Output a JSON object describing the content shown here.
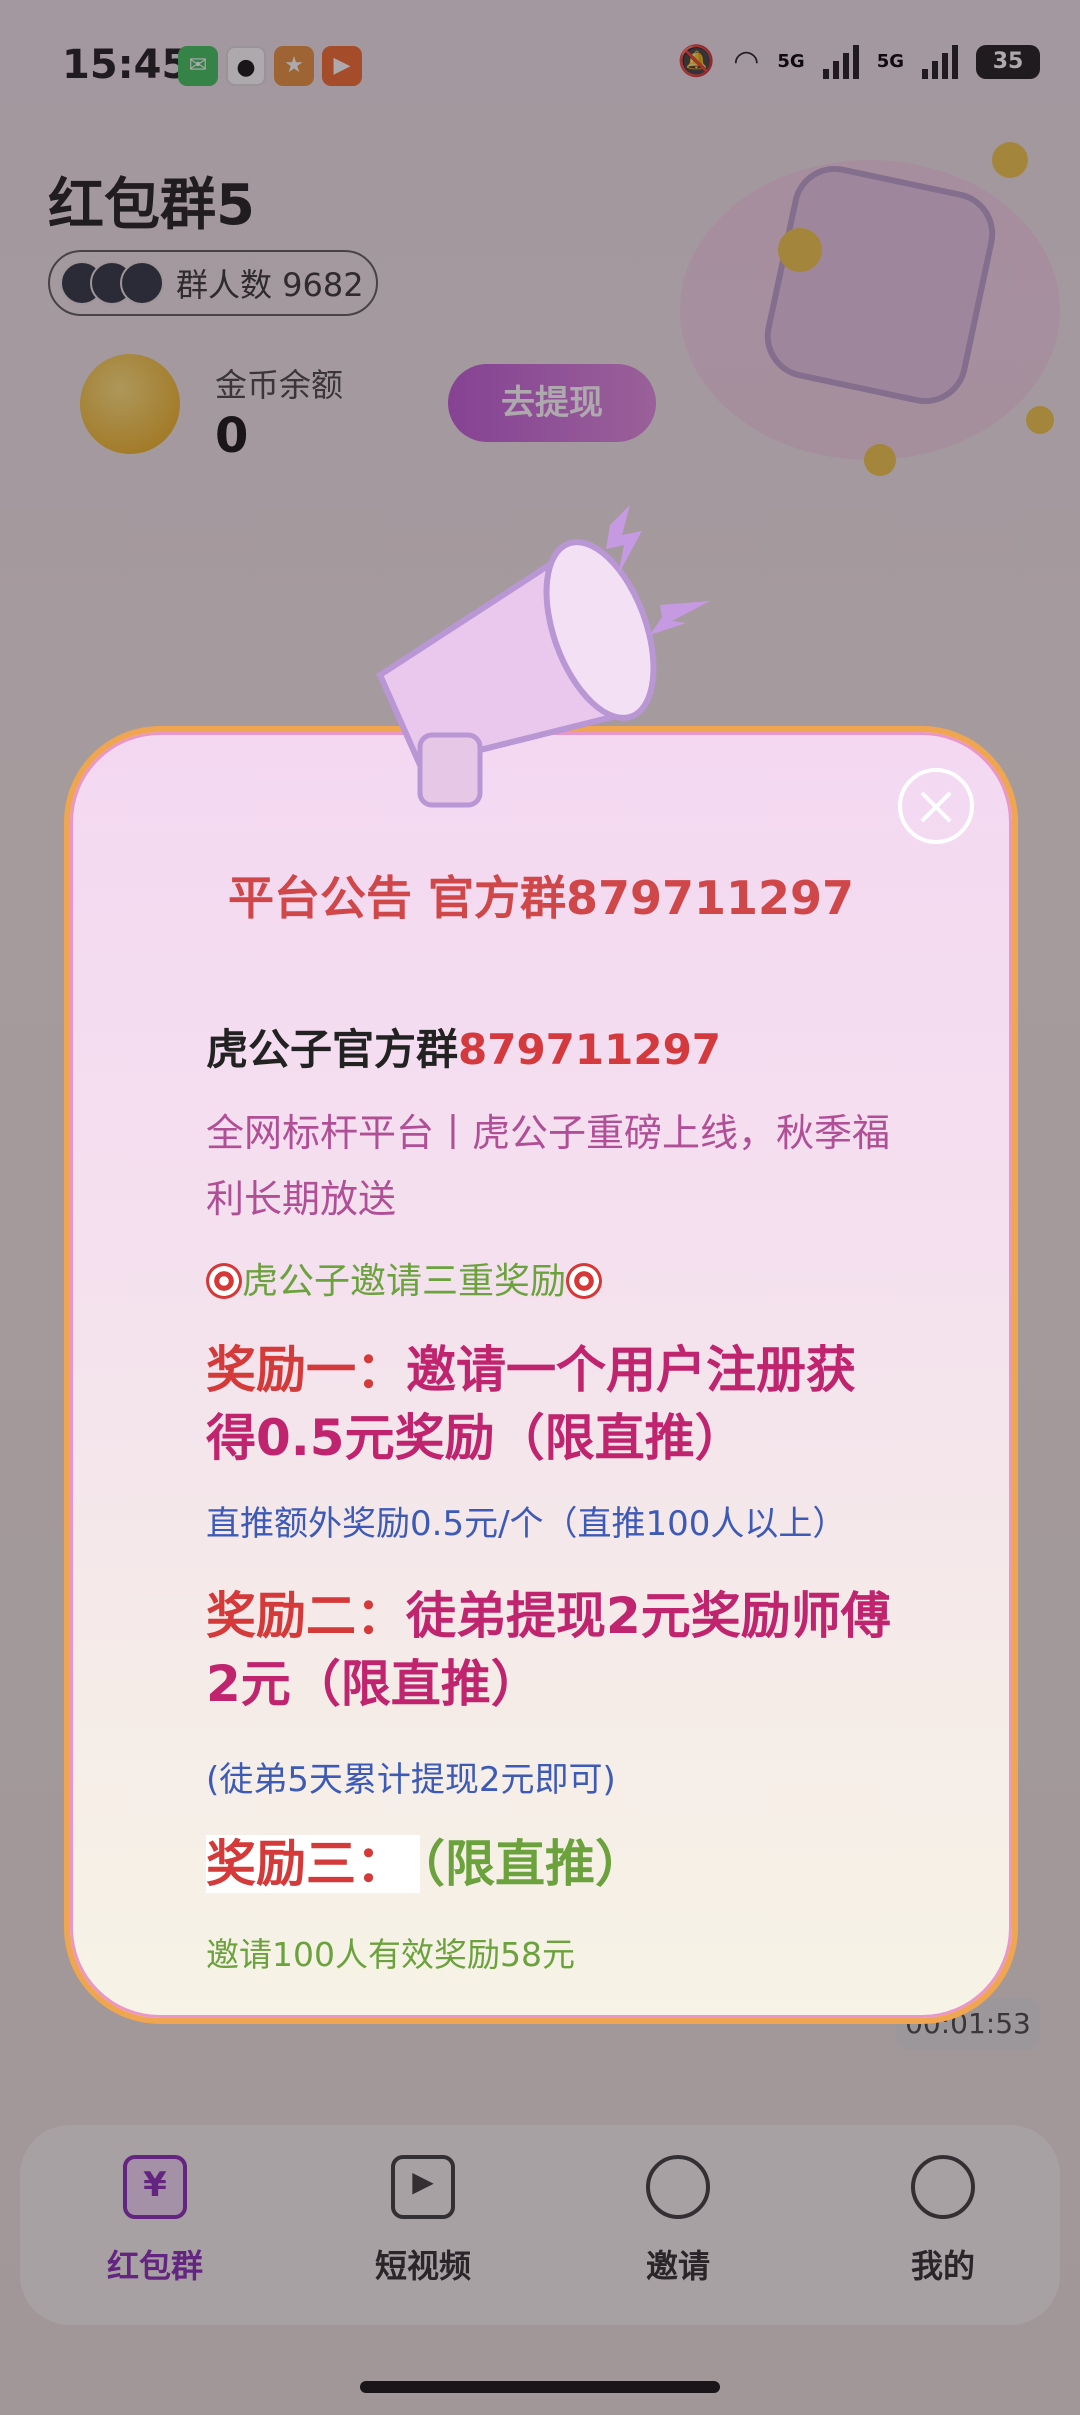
{
  "status_bar": {
    "time": "15:45",
    "network": "5G",
    "battery": "35"
  },
  "header": {
    "title": "红包群5",
    "members_label": "群人数 9682"
  },
  "balance": {
    "label": "金币余额",
    "value": "0",
    "withdraw_button": "去提现"
  },
  "timer": "00:01:53",
  "nav": {
    "items": [
      {
        "label": "红包群",
        "icon": "yen-icon"
      },
      {
        "label": "短视频",
        "icon": "video-icon"
      },
      {
        "label": "邀请",
        "icon": "users-icon"
      },
      {
        "label": "我的",
        "icon": "profile-icon"
      }
    ],
    "active": 0
  },
  "notice": {
    "title": "平台公告 官方群879711297",
    "official_prefix": "虎公子官方群",
    "official_number": "879711297",
    "intro": "全网标杆平台丨虎公子重磅上线，秋季福利长期放送",
    "reward_header": "虎公子邀请三重奖励",
    "reward1_label": "奖励一：",
    "reward1_text": "邀请一个用户注册获得0.5元奖励（限直推）",
    "reward1_note": "直推额外奖励0.5元/个（直推100人以上）",
    "reward2_label": "奖励二：",
    "reward2_text": "徒弟提现2元奖励师傅2元（限直推）",
    "reward2_note": "(徒弟5天累计提现2元即可)",
    "reward3_label": "奖励三：",
    "reward3_text": "（限直推）",
    "reward3_note": "邀请100人有效奖励58元"
  }
}
